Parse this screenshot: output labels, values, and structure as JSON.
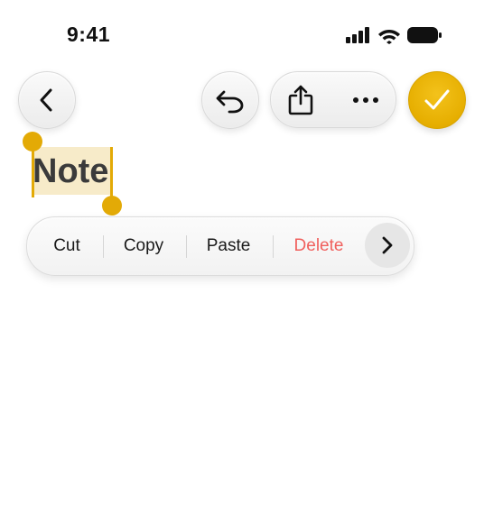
{
  "status_bar": {
    "time": "9:41",
    "icons": [
      "cellular-signal-icon",
      "wifi-icon",
      "battery-icon"
    ]
  },
  "toolbar": {
    "back_icon": "chevron-left-icon",
    "undo_icon": "undo-icon",
    "share_icon": "share-icon",
    "more_icon": "ellipsis-icon",
    "done_icon": "checkmark-icon",
    "done_color": "#e6ae00"
  },
  "note": {
    "title": "Note",
    "selection_color": "#f7ebc9",
    "selection_handle_color": "#e3aa06"
  },
  "context_menu": {
    "items": [
      {
        "label": "Cut",
        "color": "#1a1a1a"
      },
      {
        "label": "Copy",
        "color": "#1a1a1a"
      },
      {
        "label": "Paste",
        "color": "#1a1a1a"
      },
      {
        "label": "Delete",
        "color": "#f0605d"
      }
    ],
    "more_icon": "chevron-right-icon"
  }
}
